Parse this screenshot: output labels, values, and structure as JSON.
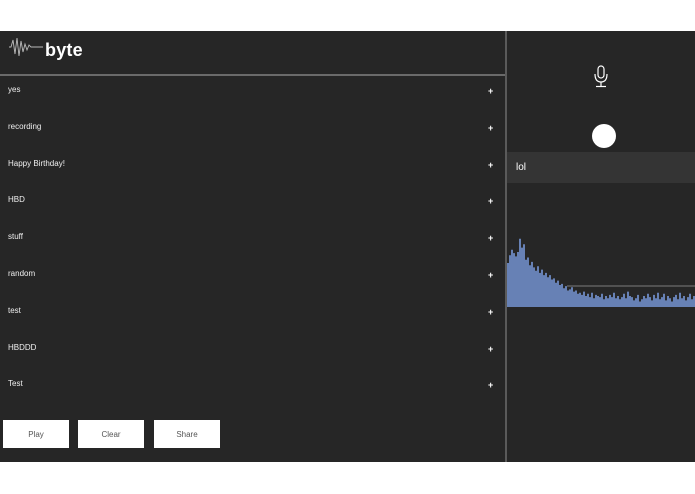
{
  "app": {
    "logo_text": "byte",
    "logo_icon": "waveform-icon"
  },
  "recordings": [
    {
      "label": "yes",
      "action": "+"
    },
    {
      "label": "recording",
      "action": "+"
    },
    {
      "label": "Happy Birthday!",
      "action": "+"
    },
    {
      "label": "HBD",
      "action": "+"
    },
    {
      "label": "stuff",
      "action": "+"
    },
    {
      "label": "random",
      "action": "+"
    },
    {
      "label": "test",
      "action": "+"
    },
    {
      "label": "HBDDD",
      "action": "+"
    },
    {
      "label": "Test",
      "action": "+"
    }
  ],
  "controls": {
    "play": "Play",
    "clear": "Clear",
    "share": "Share"
  },
  "recorder": {
    "mic_icon": "microphone-icon",
    "record_icon": "record-button-icon",
    "current_name": "lol",
    "waveform_color": "#6781b5",
    "waveform_levels": [
      0.4,
      0.47,
      0.52,
      0.49,
      0.46,
      0.5,
      0.62,
      0.54,
      0.57,
      0.43,
      0.45,
      0.38,
      0.41,
      0.36,
      0.33,
      0.37,
      0.31,
      0.34,
      0.29,
      0.31,
      0.27,
      0.29,
      0.25,
      0.26,
      0.22,
      0.24,
      0.2,
      0.21,
      0.17,
      0.19,
      0.15,
      0.16,
      0.18,
      0.14,
      0.15,
      0.12,
      0.13,
      0.11,
      0.14,
      0.1,
      0.12,
      0.09,
      0.13,
      0.08,
      0.11,
      0.1,
      0.09,
      0.12,
      0.07,
      0.1,
      0.08,
      0.11,
      0.09,
      0.13,
      0.08,
      0.1,
      0.07,
      0.09,
      0.12,
      0.08,
      0.14,
      0.1,
      0.09,
      0.06,
      0.08,
      0.11,
      0.05,
      0.07,
      0.1,
      0.08,
      0.12,
      0.09,
      0.06,
      0.11,
      0.08,
      0.13,
      0.07,
      0.09,
      0.12,
      0.06,
      0.1,
      0.08,
      0.05,
      0.09,
      0.11,
      0.07,
      0.13,
      0.08,
      0.1,
      0.06,
      0.09,
      0.12,
      0.07,
      0.1
    ]
  }
}
